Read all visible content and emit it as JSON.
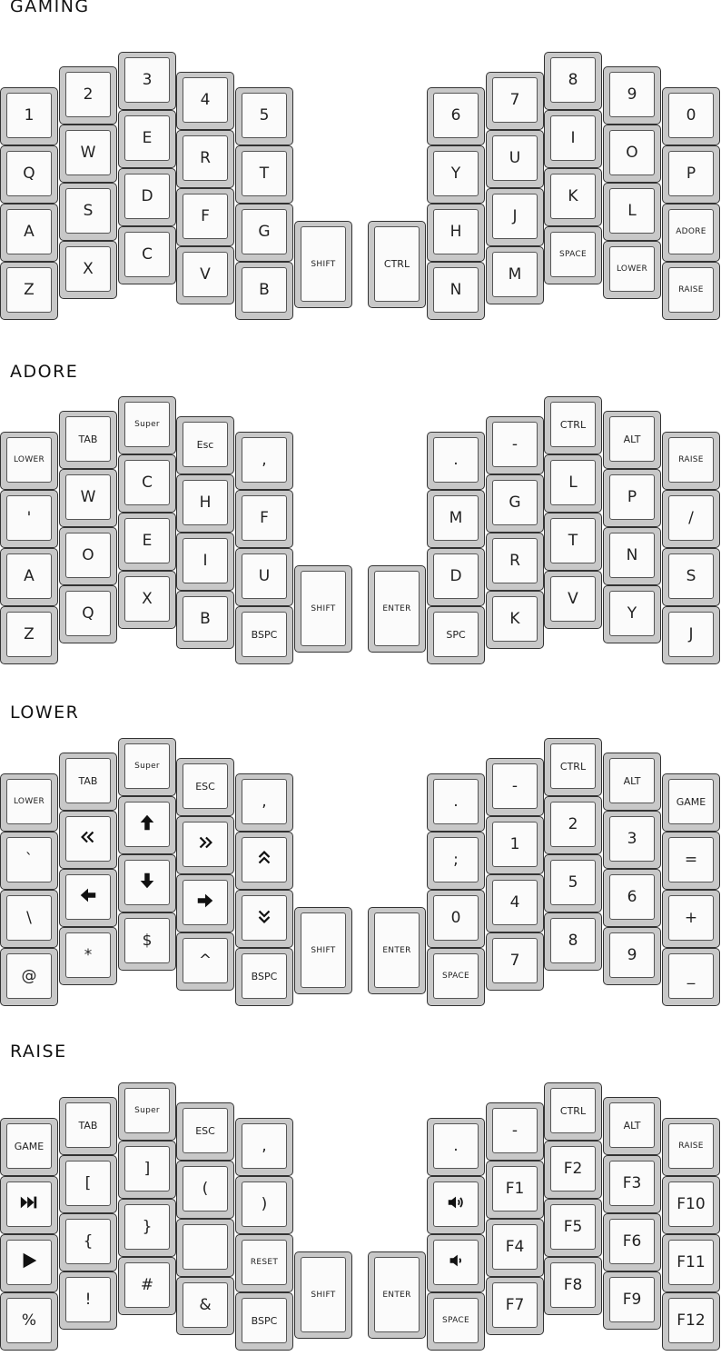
{
  "layers": [
    {
      "title": "GAMING",
      "keys": [
        [
          "1",
          "Q",
          "A",
          "Z"
        ],
        [
          "2",
          "W",
          "S",
          "X"
        ],
        [
          "3",
          "E",
          "D",
          "C"
        ],
        [
          "4",
          "R",
          "F",
          "V"
        ],
        [
          "5",
          "T",
          "G",
          "B"
        ],
        [
          "SHIFT"
        ],
        [
          "CTRL"
        ],
        [
          "6",
          "Y",
          "H",
          "N"
        ],
        [
          "7",
          "U",
          "J",
          "M"
        ],
        [
          "8",
          "I",
          "K",
          "SPACE"
        ],
        [
          "9",
          "O",
          "L",
          "LOWER"
        ],
        [
          "0",
          "P",
          "ADORE",
          "RAISE"
        ]
      ]
    },
    {
      "title": "ADORE",
      "keys": [
        [
          "LOWER",
          "'",
          "A",
          "Z"
        ],
        [
          "TAB",
          "W",
          "O",
          "Q"
        ],
        [
          "Super",
          "C",
          "E",
          "X"
        ],
        [
          "Esc",
          "H",
          "I",
          "B"
        ],
        [
          ",",
          "F",
          "U",
          "BSPC"
        ],
        [
          "SHIFT"
        ],
        [
          "ENTER"
        ],
        [
          ".",
          "M",
          "D",
          "SPC"
        ],
        [
          "-",
          "G",
          "R",
          "K"
        ],
        [
          "CTRL",
          "L",
          "T",
          "V"
        ],
        [
          "ALT",
          "P",
          "N",
          "Y"
        ],
        [
          "RAISE",
          "/",
          "S",
          "J"
        ]
      ]
    },
    {
      "title": "LOWER",
      "keys": [
        [
          "LOWER",
          "`",
          "\\",
          "@"
        ],
        [
          "TAB",
          "«",
          "←",
          "*"
        ],
        [
          "Super",
          "↑",
          "↓",
          "$"
        ],
        [
          "ESC",
          "»",
          "→",
          "^"
        ],
        [
          ",",
          "⌃",
          "⌄",
          "BSPC"
        ],
        [
          "SHIFT"
        ],
        [
          "ENTER"
        ],
        [
          ".",
          ";",
          "0",
          "SPACE"
        ],
        [
          "-",
          "1",
          "4",
          "7"
        ],
        [
          "CTRL",
          "2",
          "5",
          "8"
        ],
        [
          "ALT",
          "3",
          "6",
          "9"
        ],
        [
          "GAME",
          "=",
          "+",
          "_"
        ]
      ]
    },
    {
      "title": "RAISE",
      "keys": [
        [
          "GAME",
          "⏭",
          "▶",
          "%"
        ],
        [
          "TAB",
          "[",
          "{",
          "!"
        ],
        [
          "Super",
          "]",
          "}",
          "#"
        ],
        [
          "ESC",
          "(",
          "",
          "&"
        ],
        [
          ",",
          ")",
          "RESET",
          "BSPC"
        ],
        [
          "SHIFT"
        ],
        [
          "ENTER"
        ],
        [
          ".",
          "🔊",
          "🔉",
          "SPACE"
        ],
        [
          "-",
          "F1",
          "F4",
          "F7"
        ],
        [
          "CTRL",
          "F2",
          "F5",
          "F8"
        ],
        [
          "ALT",
          "F3",
          "F6",
          "F9"
        ],
        [
          "RAISE",
          "F10",
          "F11",
          "F12"
        ]
      ]
    }
  ],
  "icons": {
    "↑": "arrow-up-icon",
    "↓": "arrow-down-icon",
    "←": "arrow-left-icon",
    "→": "arrow-right-icon",
    "⏭": "next-track-icon",
    "▶": "play-icon",
    "🔊": "volume-up-icon",
    "🔉": "volume-down-icon",
    "«": "double-left-icon",
    "»": "double-right-icon",
    "⌃": "double-up-icon",
    "⌄": "double-down-icon"
  }
}
